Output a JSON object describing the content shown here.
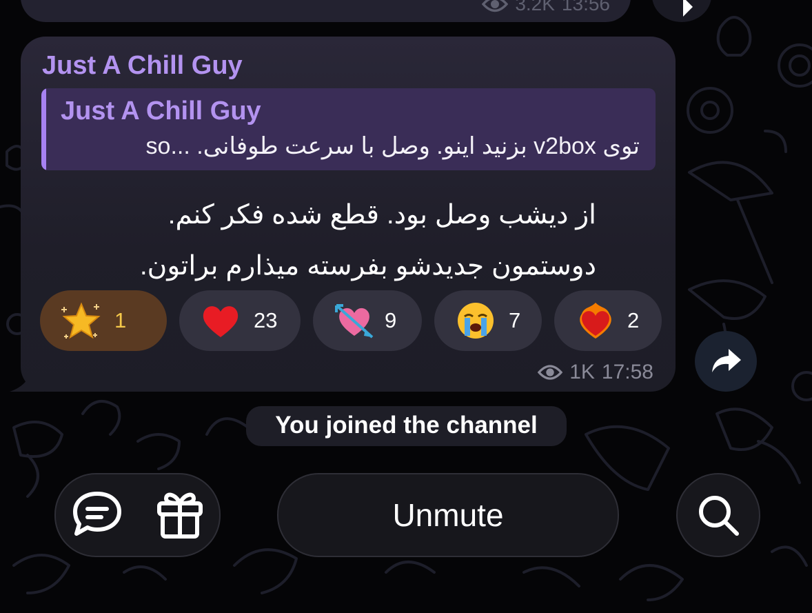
{
  "previous_message": {
    "views": "3.2K",
    "time": "13:56"
  },
  "message": {
    "sender": "Just A Chill Guy",
    "reply": {
      "name": "Just A Chill Guy",
      "text": "توی v2box بزنید اینو. وصل با سرعت طوفانی. ...so"
    },
    "lines": [
      "از دیشب وصل بود. قطع شده فکر کنم.",
      "دوستمون جدیدشو بفرسته میذارم براتون."
    ],
    "reactions": [
      {
        "emoji": "star-emoji",
        "count": "1",
        "active": true
      },
      {
        "emoji": "red-heart-emoji",
        "count": "23",
        "active": false
      },
      {
        "emoji": "heart-with-arrow-emoji",
        "count": "9",
        "active": false
      },
      {
        "emoji": "loudly-crying-face-emoji",
        "count": "7",
        "active": false
      },
      {
        "emoji": "heart-on-fire-emoji",
        "count": "2",
        "active": false
      }
    ],
    "views": "1K",
    "time": "17:58"
  },
  "service_message": "You joined the channel",
  "bottom_bar": {
    "unmute_label": "Unmute",
    "icons": [
      "comments-icon",
      "gift-icon",
      "search-icon"
    ]
  },
  "colors": {
    "background": "#050507",
    "bubble": "#23222e",
    "accent": "#b393f0",
    "reply_background": "#3a2d57",
    "star_reaction": "#5a3a22"
  }
}
